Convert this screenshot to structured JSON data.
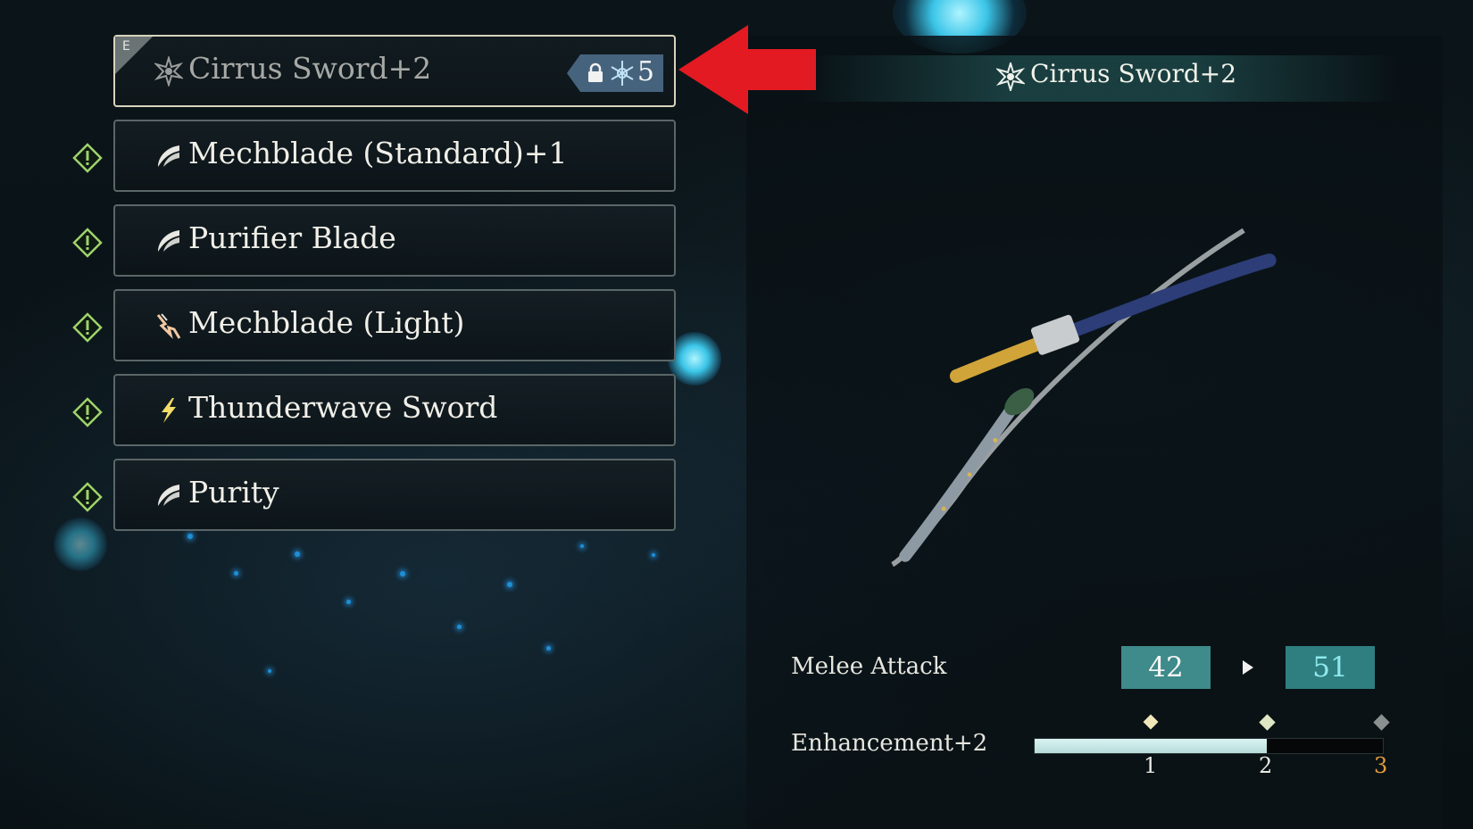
{
  "weapon_list": [
    {
      "name": "Cirrus Sword+2",
      "selected": true,
      "tag": "E",
      "lock_count": "5",
      "icon": "burst-star-icon"
    },
    {
      "name": "Mechblade (Standard)+1",
      "selected": false,
      "icon": "wind-slash-icon"
    },
    {
      "name": "Purifier Blade",
      "selected": false,
      "icon": "wind-slash-icon"
    },
    {
      "name": "Mechblade (Light)",
      "selected": false,
      "icon": "lightning-claw-icon"
    },
    {
      "name": "Thunderwave Sword",
      "selected": false,
      "icon": "lightning-bolt-icon"
    },
    {
      "name": "Purity",
      "selected": false,
      "icon": "wind-slash-icon"
    }
  ],
  "details": {
    "title": "Cirrus Sword+2",
    "stats": [
      {
        "label": "Melee Attack",
        "current": "42",
        "next": "51"
      }
    ],
    "enhancement": {
      "label": "Enhancement+2",
      "level": 2,
      "max": 3,
      "ticks": [
        "1",
        "2",
        "3"
      ]
    }
  },
  "colors": {
    "accent": "#3f8a8a",
    "highlight_next": "#8fe9ee",
    "next_tick": "#e39b3c",
    "arrow": "#e31a22",
    "warning": "#9fd36b"
  }
}
